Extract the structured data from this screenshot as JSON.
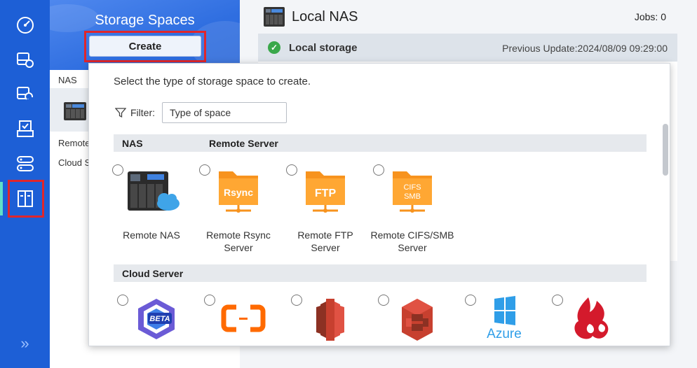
{
  "colors": {
    "rail": "#1d5fd6",
    "accent_highlight": "#e0262b",
    "folder_orange": "#f7931e",
    "success_green": "#3aa84b"
  },
  "rail": {
    "items": [
      {
        "name": "dashboard",
        "icon": "speedometer-icon"
      },
      {
        "name": "backup",
        "icon": "backup-server-icon"
      },
      {
        "name": "sync",
        "icon": "sync-server-icon"
      },
      {
        "name": "tasks",
        "icon": "task-list-icon"
      },
      {
        "name": "services",
        "icon": "server-stack-icon"
      },
      {
        "name": "storage-spaces",
        "icon": "storage-cabinet-icon",
        "active": true
      }
    ],
    "expand_icon": "double-chevron-right-icon",
    "expand_glyph": "»"
  },
  "panel": {
    "title": "Storage Spaces",
    "create_label": "Create",
    "sections": {
      "nas": "NAS",
      "remote": "Remote",
      "cloud": "Cloud S"
    }
  },
  "main": {
    "title": "Local NAS",
    "jobs": "Jobs: 0",
    "local_storage": {
      "label": "Local storage",
      "check_glyph": "✓",
      "updated": "Previous Update:2024/08/09 09:29:00"
    }
  },
  "popup": {
    "instruction": "Select the type of storage space to create.",
    "filter_label": "Filter:",
    "filter_placeholder": "Type of space",
    "sections": {
      "nas": "NAS",
      "remote_server": "Remote Server",
      "cloud_server": "Cloud Server"
    },
    "types": [
      {
        "id": "remote-nas",
        "label": "Remote NAS",
        "icon": "nas-cloud-icon"
      },
      {
        "id": "remote-rsync",
        "label": "Remote Rsync Server",
        "icon": "rsync-folder-icon",
        "badge": "Rsync"
      },
      {
        "id": "remote-ftp",
        "label": "Remote FTP Server",
        "icon": "ftp-folder-icon",
        "badge": "FTP"
      },
      {
        "id": "remote-cifs",
        "label": "Remote CIFS/SMB Server",
        "icon": "cifs-folder-icon",
        "badge_line1": "CIFS",
        "badge_line2": "SMB"
      }
    ],
    "cloud_types": [
      {
        "id": "beta-cloud",
        "icon": "beta-cloud-icon",
        "badge": "BETA"
      },
      {
        "id": "alibaba-cloud",
        "icon": "alibaba-cloud-icon"
      },
      {
        "id": "amazon-s3",
        "icon": "amazon-s3-icon"
      },
      {
        "id": "amazon-glacier",
        "icon": "amazon-glacier-icon"
      },
      {
        "id": "azure",
        "icon": "azure-icon",
        "badge": "Azure"
      },
      {
        "id": "backblaze",
        "icon": "backblaze-icon"
      }
    ]
  }
}
